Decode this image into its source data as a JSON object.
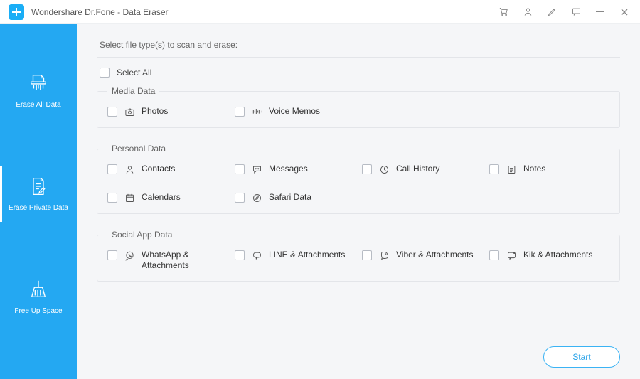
{
  "window": {
    "title": "Wondershare Dr.Fone - Data Eraser",
    "titlebar_icons": [
      "cart",
      "user",
      "edit",
      "feedback",
      "minimize",
      "close"
    ]
  },
  "sidebar": {
    "items": [
      {
        "label": "Erase All Data",
        "icon": "shredder"
      },
      {
        "label": "Erase Private Data",
        "icon": "doc-edit"
      },
      {
        "label": "Free Up Space",
        "icon": "broom"
      }
    ],
    "active_index": 1
  },
  "main": {
    "heading": "Select file type(s) to scan and erase:",
    "select_all_label": "Select All",
    "groups": [
      {
        "title": "Media Data",
        "items": [
          {
            "label": "Photos",
            "icon": "camera"
          },
          {
            "label": "Voice Memos",
            "icon": "waveform"
          }
        ]
      },
      {
        "title": "Personal Data",
        "items": [
          {
            "label": "Contacts",
            "icon": "person"
          },
          {
            "label": "Messages",
            "icon": "chat"
          },
          {
            "label": "Call History",
            "icon": "clock"
          },
          {
            "label": "Notes",
            "icon": "note"
          },
          {
            "label": "Calendars",
            "icon": "calendar"
          },
          {
            "label": "Safari Data",
            "icon": "compass"
          }
        ]
      },
      {
        "title": "Social App Data",
        "items": [
          {
            "label": "WhatsApp & Attachments",
            "icon": "whatsapp"
          },
          {
            "label": "LINE & Attachments",
            "icon": "line"
          },
          {
            "label": "Viber & Attachments",
            "icon": "viber"
          },
          {
            "label": "Kik & Attachments",
            "icon": "kik"
          }
        ]
      }
    ],
    "start_label": "Start"
  }
}
